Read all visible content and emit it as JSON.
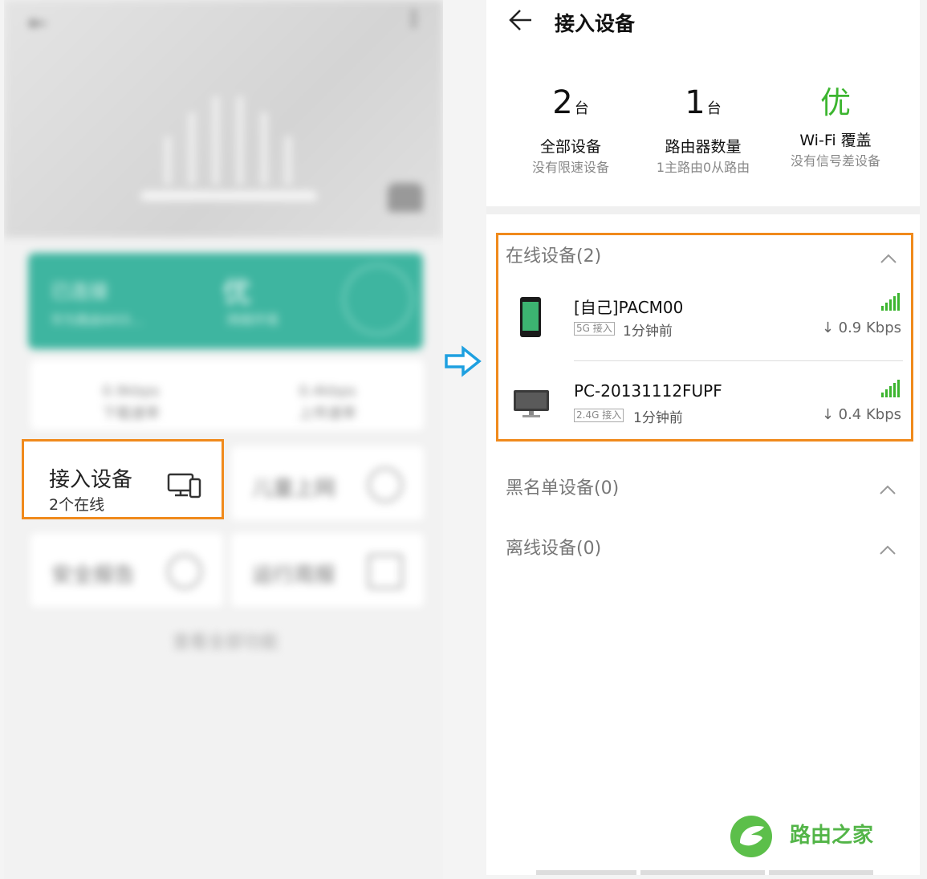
{
  "left": {
    "banner": {
      "status": "已连接",
      "ssid": "华为路由WS5…",
      "grade": "优",
      "grade_label": "网络环境"
    },
    "speed": {
      "down_value": "0.9kbps",
      "down_label": "下载速率",
      "up_value": "0.4kbps",
      "up_label": "上传速率"
    },
    "cards": {
      "connected_devices": {
        "title": "接入设备",
        "subtitle": "2个在线",
        "icon": "devices-icon"
      },
      "child_online": {
        "title": "儿童上网",
        "icon": "bulb-icon"
      },
      "security": {
        "title": "安全报告",
        "icon": "shield-icon"
      },
      "run_report": {
        "title": "运行周报",
        "icon": "chart-icon"
      }
    },
    "more_features": "查看全部功能"
  },
  "right": {
    "header": {
      "title": "接入设备"
    },
    "stats": [
      {
        "value": "2",
        "unit": "台",
        "label": "全部设备",
        "desc": "没有限速设备"
      },
      {
        "value": "1",
        "unit": "台",
        "label": "路由器数量",
        "desc": "1主路由0从路由"
      },
      {
        "value": "优",
        "unit": "",
        "label": "Wi-Fi 覆盖",
        "desc": "没有信号差设备"
      }
    ],
    "sections": {
      "online": {
        "title": "在线设备(2)",
        "devices": [
          {
            "name": "[自己]PACM00",
            "band": "5G 接入",
            "time": "1分钟前",
            "speed": "↓ 0.9 Kbps",
            "icon": "phone-icon"
          },
          {
            "name": "PC-20131112FUPF",
            "band": "2.4G 接入",
            "time": "1分钟前",
            "speed": "↓ 0.4 Kbps",
            "icon": "monitor-icon"
          }
        ]
      },
      "blacklist": {
        "title": "黑名单设备(0)"
      },
      "offline": {
        "title": "离线设备(0)"
      }
    }
  },
  "watermark": "路由之家",
  "colors": {
    "accent_orange": "#f08a1c",
    "good_green": "#3cb52f",
    "arrow_blue": "#1ea0e0",
    "teal": "#3eb5a0"
  }
}
